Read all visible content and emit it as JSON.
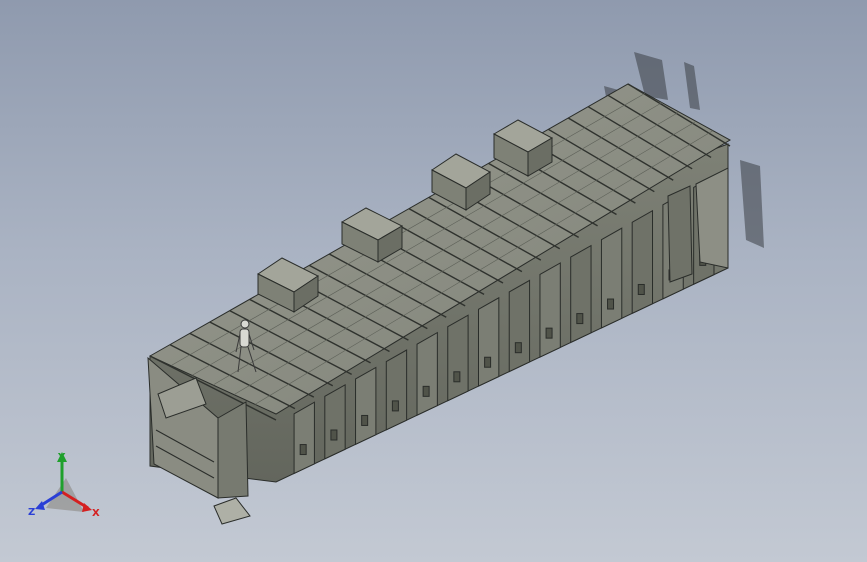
{
  "viewport": {
    "background_top": "#8f9aae",
    "background_bottom": "#c3c9d3",
    "model_color": "#8f9186",
    "edge_color": "#2a2d2a"
  },
  "triad": {
    "x_label": "X",
    "y_label": "Y",
    "z_label": "Z",
    "x_color": "#d42020",
    "y_color": "#1fa02c",
    "z_color": "#2a3fd6"
  }
}
